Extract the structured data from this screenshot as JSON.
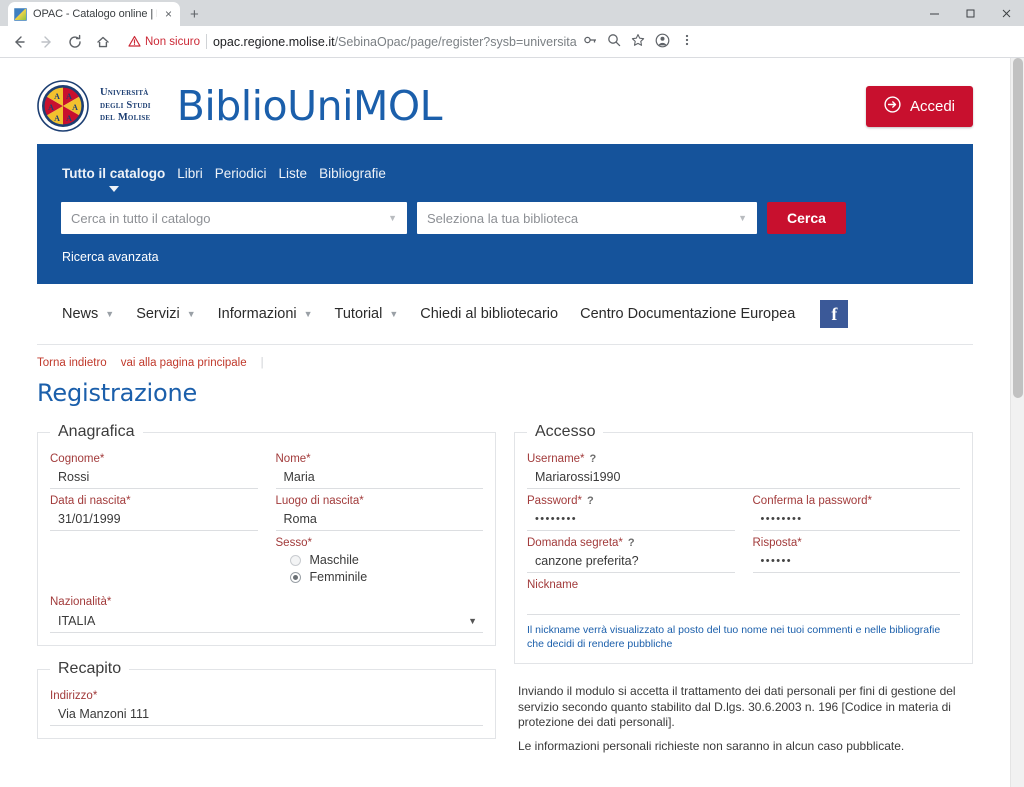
{
  "browser": {
    "tab": {
      "title": "OPAC - Catalogo online | Registr",
      "close_label": "×",
      "favicon_name": "site-favicon"
    },
    "new_tab_label": "+",
    "window": {
      "minimize": "–",
      "maximize": "□",
      "close": "✕"
    },
    "nav": {
      "back": "←",
      "forward": "→",
      "reload": "↻",
      "home": "⌂"
    },
    "security": {
      "warning_icon": "⚠",
      "label": "Non sicuro"
    },
    "url": {
      "host": "opac.regione.molise.it",
      "path": "/SebinaOpac/page/register?sysb=universita"
    },
    "omni_icons": [
      "key-icon",
      "zoom-icon",
      "star-icon",
      "profile-icon",
      "menu-icon"
    ]
  },
  "site": {
    "university_lines": [
      "Università",
      "degli Studi",
      "del Molise"
    ],
    "brand": "BiblioUniMOL",
    "login_button": "Accedi"
  },
  "search": {
    "tabs": [
      {
        "label": "Tutto il catalogo",
        "active": true
      },
      {
        "label": "Libri",
        "active": false
      },
      {
        "label": "Periodici",
        "active": false
      },
      {
        "label": "Liste",
        "active": false
      },
      {
        "label": "Bibliografie",
        "active": false
      }
    ],
    "query_placeholder": "Cerca in tutto il catalogo",
    "library_placeholder": "Seleziona la tua biblioteca",
    "submit_label": "Cerca",
    "advanced_link": "Ricerca avanzata"
  },
  "mainnav": {
    "items": [
      {
        "label": "News",
        "caret": true
      },
      {
        "label": "Servizi",
        "caret": true
      },
      {
        "label": "Informazioni",
        "caret": true
      },
      {
        "label": "Tutorial",
        "caret": true
      },
      {
        "label": "Chiedi al bibliotecario",
        "caret": false
      },
      {
        "label": "Centro Documentazione Europea",
        "caret": false
      }
    ],
    "facebook_label": "f"
  },
  "breadcrumb": {
    "back": "Torna indietro",
    "home": "vai alla pagina principale"
  },
  "page": {
    "title": "Registrazione"
  },
  "anagrafica": {
    "legend": "Anagrafica",
    "cognome": {
      "label": "Cognome*",
      "value": "Rossi"
    },
    "nome": {
      "label": "Nome*",
      "value": "Maria"
    },
    "data_nascita": {
      "label": "Data di nascita*",
      "value": "31/01/1999"
    },
    "luogo_nascita": {
      "label": "Luogo di nascita*",
      "value": "Roma"
    },
    "sesso": {
      "label": "Sesso*",
      "options": [
        {
          "label": "Maschile",
          "selected": false
        },
        {
          "label": "Femminile",
          "selected": true
        }
      ]
    },
    "nazionalita": {
      "label": "Nazionalità*",
      "value": "ITALIA"
    }
  },
  "recapito": {
    "legend": "Recapito",
    "indirizzo": {
      "label": "Indirizzo*",
      "value": "Via Manzoni 111"
    }
  },
  "accesso": {
    "legend": "Accesso",
    "username": {
      "label": "Username*",
      "help": "?",
      "value": "Mariarossi1990"
    },
    "password": {
      "label": "Password*",
      "help": "?",
      "value": "••••••••"
    },
    "conferma_password": {
      "label": "Conferma la password*",
      "value": "••••••••"
    },
    "domanda_segreta": {
      "label": "Domanda segreta*",
      "help": "?",
      "value": "canzone preferita?"
    },
    "risposta": {
      "label": "Risposta*",
      "value": "••••••"
    },
    "nickname": {
      "label": "Nickname",
      "value": ""
    },
    "nickname_hint": "Il nickname verrà visualizzato al posto del tuo nome nei tuoi commenti e nelle bibliografie che decidi di rendere pubbliche"
  },
  "legal": {
    "p1": "Inviando il modulo si accetta il trattamento dei dati personali per fini di gestione del servizio secondo quanto stabilito dal D.lgs. 30.6.2003 n. 196 [Codice in materia di protezione dei dati personali].",
    "p2": "Le informazioni personali richieste non saranno in alcun caso pubblicate."
  },
  "colors": {
    "brand_blue": "#1b5fab",
    "band_blue": "#15539b",
    "accent_red": "#c8102e",
    "label_red": "#a23b3b",
    "link_red": "#c0392b"
  }
}
